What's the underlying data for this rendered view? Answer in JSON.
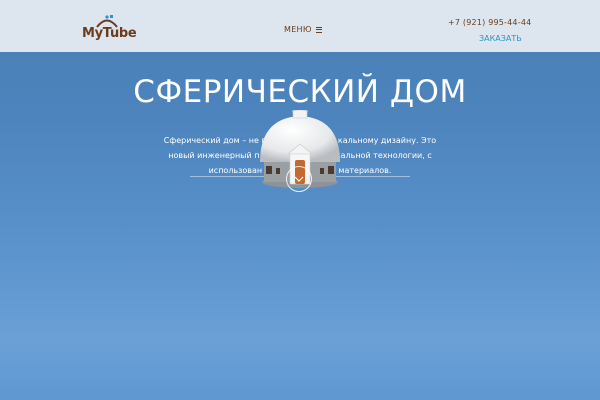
{
  "header": {
    "logo_text": "MyTube",
    "menu_label": "МЕНЮ",
    "phone": "+7 (921) 995-44-44",
    "order_label": "ЗАКАЗАТЬ"
  },
  "hero": {
    "title": "СФЕРИЧЕСКИЙ ДОМ",
    "description": "Сферический дом – не п                            кальному дизайну. Это новый инженерный п                              кальной технологии, с использован                              материалов."
  },
  "icons": {
    "menu": "hamburger-icon",
    "scroll": "chevron-down-icon"
  },
  "colors": {
    "brand_brown": "#6b3d1d",
    "accent_blue": "#2c95c8",
    "header_bg": "#dde5ee",
    "sky": "#4d84bd"
  }
}
